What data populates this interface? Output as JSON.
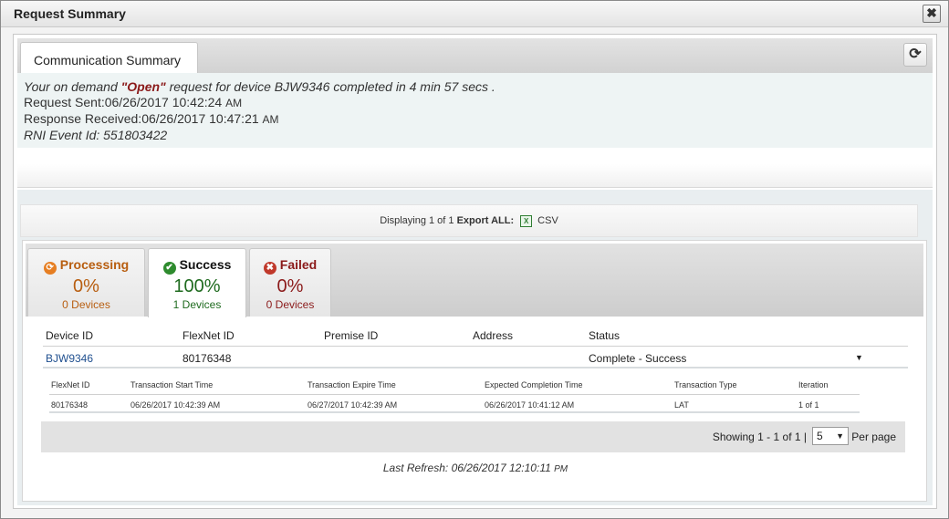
{
  "window": {
    "title": "Request Summary",
    "close_label": "✖"
  },
  "tabs": {
    "communication_summary": "Communication Summary",
    "refresh_label": "⟳"
  },
  "info": {
    "line1_prefix": "Your on demand ",
    "request_type": "\"Open\"",
    "line1_suffix": " request for device BJW9346 completed in 4 min 57 secs .",
    "request_sent_label": "Request Sent:",
    "request_sent_value": "06/26/2017 10:42:24",
    "request_sent_ampm": "AM",
    "response_received_label": "Response Received:",
    "response_received_value": "06/26/2017 10:47:21",
    "response_received_ampm": "AM",
    "rni_event": "RNI Event Id: 551803422"
  },
  "display_bar": {
    "displaying": "Displaying 1 of 1",
    "export_all": "Export ALL:",
    "csv_label": "CSV",
    "csv_icon_text": "X"
  },
  "status_tabs": {
    "processing": {
      "title": "Processing",
      "percent": "0%",
      "count": "0 Devices",
      "icon": "⟳"
    },
    "success": {
      "title": "Success",
      "percent": "100%",
      "count": "1 Devices",
      "icon": "✔"
    },
    "failed": {
      "title": "Failed",
      "percent": "0%",
      "count": "0 Devices",
      "icon": "✖"
    }
  },
  "device_table": {
    "headers": {
      "device_id": "Device ID",
      "flexnet_id": "FlexNet ID",
      "premise_id": "Premise ID",
      "address": "Address",
      "status": "Status"
    },
    "row": {
      "device_id": "BJW9346",
      "flexnet_id": "80176348",
      "premise_id": "",
      "address": "",
      "status": "Complete - Success",
      "expand_icon": "▼"
    }
  },
  "transaction_table": {
    "headers": {
      "flexnet_id": "FlexNet ID",
      "start_time": "Transaction Start Time",
      "expire_time": "Transaction Expire Time",
      "expected_completion": "Expected Completion Time",
      "type": "Transaction Type",
      "iteration": "Iteration"
    },
    "row": {
      "flexnet_id": "80176348",
      "start_time": "06/26/2017 10:42:39 AM",
      "expire_time": "06/27/2017 10:42:39 AM",
      "expected_completion": "06/26/2017 10:41:12 AM",
      "type": "LAT",
      "iteration": "1 of 1"
    }
  },
  "pager": {
    "showing": "Showing 1 - 1 of 1 |",
    "per_page_value": "5",
    "per_page_label": "Per page",
    "arrow": "▼"
  },
  "last_refresh": {
    "label": "Last Refresh: ",
    "value": "06/26/2017 12:10:11",
    "ampm": "PM"
  }
}
